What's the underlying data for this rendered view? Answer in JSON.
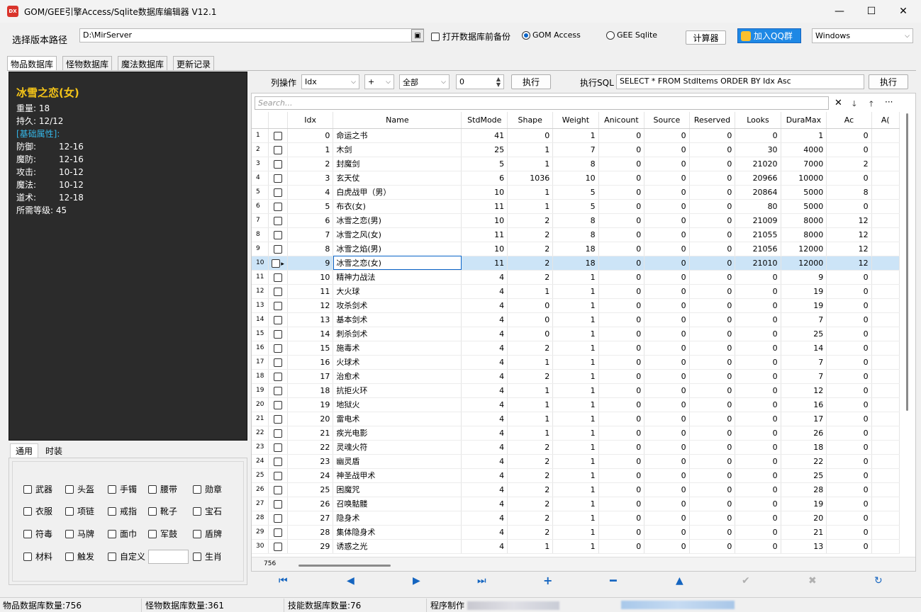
{
  "window": {
    "title": "GOM/GEE引擎Access/Sqlite数据库编辑器 V12.1",
    "icon_text": "DX",
    "minimize": "—",
    "maximize": "☐",
    "close": "✕"
  },
  "top": {
    "path_label": "选择版本路径",
    "path_value": "D:\\MirServer",
    "backup_label": "打开数据库前备份",
    "gom_label": "GOM Access",
    "gee_label": "GEE Sqlite",
    "calc_label": "计算器",
    "qq_label": "加入QQ群",
    "theme_value": "Windows"
  },
  "tabs": [
    "物品数据库",
    "怪物数据库",
    "魔法数据库",
    "更新记录"
  ],
  "preview": {
    "name": "冰雪之恋(女)",
    "lines": [
      "重量: 18",
      "持久: 12/12"
    ],
    "section": "[基础属性]:",
    "attrs": [
      {
        "k": "防御:",
        "v": "12-16"
      },
      {
        "k": "魔防:",
        "v": "12-16"
      },
      {
        "k": "攻击:",
        "v": "10-12"
      },
      {
        "k": "魔法:",
        "v": "10-12"
      },
      {
        "k": "道术:",
        "v": "12-18"
      }
    ],
    "level": "所需等级: 45",
    "name_color": "#f5c518",
    "section_color": "#35b7e8"
  },
  "subtabs": [
    "通用",
    "时装"
  ],
  "categories": [
    [
      "武器",
      "头盔",
      "手镯",
      "腰带",
      "勋章"
    ],
    [
      "衣服",
      "项链",
      "戒指",
      "靴子",
      "宝石"
    ],
    [
      "符毒",
      "马牌",
      "面巾",
      "军鼓",
      "盾牌"
    ],
    [
      "材料",
      "触发",
      "自定义",
      "生肖"
    ]
  ],
  "toolbar": {
    "col_op_label": "列操作",
    "col_value": "Idx",
    "op_value": "+",
    "scope_value": "全部",
    "num_value": "0",
    "exec_label": "执行",
    "sql_label": "执行SQL",
    "sql_value": "SELECT * FROM StdItems ORDER BY Idx Asc",
    "exec2_label": "执行"
  },
  "search": {
    "placeholder": "Search..."
  },
  "grid": {
    "columns": [
      "Idx",
      "Name",
      "StdMode",
      "Shape",
      "Weight",
      "Anicount",
      "Source",
      "Reserved",
      "Looks",
      "DuraMax",
      "Ac",
      "A("
    ],
    "rows": [
      [
        1,
        0,
        "命运之书",
        41,
        0,
        1,
        0,
        0,
        0,
        0,
        1,
        0
      ],
      [
        2,
        1,
        "木剑",
        25,
        1,
        7,
        0,
        0,
        0,
        30,
        4000,
        0
      ],
      [
        3,
        2,
        "封魔剑",
        5,
        1,
        8,
        0,
        0,
        0,
        21020,
        7000,
        2
      ],
      [
        4,
        3,
        "玄天仗",
        6,
        1036,
        10,
        0,
        0,
        0,
        20966,
        10000,
        0
      ],
      [
        5,
        4,
        "白虎战甲（男）",
        10,
        1,
        5,
        0,
        0,
        0,
        20864,
        5000,
        8
      ],
      [
        6,
        5,
        "布衣(女)",
        11,
        1,
        5,
        0,
        0,
        0,
        80,
        5000,
        0
      ],
      [
        7,
        6,
        "冰雪之恋(男)",
        10,
        2,
        8,
        0,
        0,
        0,
        21009,
        8000,
        12
      ],
      [
        8,
        7,
        "冰雪之风(女)",
        11,
        2,
        8,
        0,
        0,
        0,
        21055,
        8000,
        12
      ],
      [
        9,
        8,
        "冰雪之焰(男)",
        10,
        2,
        18,
        0,
        0,
        0,
        21056,
        12000,
        12
      ],
      [
        10,
        9,
        "冰雪之恋(女)",
        11,
        2,
        18,
        0,
        0,
        0,
        21010,
        12000,
        12
      ],
      [
        11,
        10,
        "精神力战法",
        4,
        2,
        1,
        0,
        0,
        0,
        0,
        9,
        0
      ],
      [
        12,
        11,
        "大火球",
        4,
        1,
        1,
        0,
        0,
        0,
        0,
        19,
        0
      ],
      [
        13,
        12,
        "攻杀剑术",
        4,
        0,
        1,
        0,
        0,
        0,
        0,
        19,
        0
      ],
      [
        14,
        13,
        "基本剑术",
        4,
        0,
        1,
        0,
        0,
        0,
        0,
        7,
        0
      ],
      [
        15,
        14,
        "刺杀剑术",
        4,
        0,
        1,
        0,
        0,
        0,
        0,
        25,
        0
      ],
      [
        16,
        15,
        "施毒术",
        4,
        2,
        1,
        0,
        0,
        0,
        0,
        14,
        0
      ],
      [
        17,
        16,
        "火球术",
        4,
        1,
        1,
        0,
        0,
        0,
        0,
        7,
        0
      ],
      [
        18,
        17,
        "治愈术",
        4,
        2,
        1,
        0,
        0,
        0,
        0,
        7,
        0
      ],
      [
        19,
        18,
        "抗拒火环",
        4,
        1,
        1,
        0,
        0,
        0,
        0,
        12,
        0
      ],
      [
        20,
        19,
        "地狱火",
        4,
        1,
        1,
        0,
        0,
        0,
        0,
        16,
        0
      ],
      [
        21,
        20,
        "雷电术",
        4,
        1,
        1,
        0,
        0,
        0,
        0,
        17,
        0
      ],
      [
        22,
        21,
        "疾光电影",
        4,
        1,
        1,
        0,
        0,
        0,
        0,
        26,
        0
      ],
      [
        23,
        22,
        "灵魂火符",
        4,
        2,
        1,
        0,
        0,
        0,
        0,
        18,
        0
      ],
      [
        24,
        23,
        "幽灵盾",
        4,
        2,
        1,
        0,
        0,
        0,
        0,
        22,
        0
      ],
      [
        25,
        24,
        "神圣战甲术",
        4,
        2,
        1,
        0,
        0,
        0,
        0,
        25,
        0
      ],
      [
        26,
        25,
        "困魔咒",
        4,
        2,
        1,
        0,
        0,
        0,
        0,
        28,
        0
      ],
      [
        27,
        26,
        "召唤骷髅",
        4,
        2,
        1,
        0,
        0,
        0,
        0,
        19,
        0
      ],
      [
        28,
        27,
        "隐身术",
        4,
        2,
        1,
        0,
        0,
        0,
        0,
        20,
        0
      ],
      [
        29,
        28,
        "集体隐身术",
        4,
        2,
        1,
        0,
        0,
        0,
        0,
        21,
        0
      ],
      [
        30,
        29,
        "诱惑之光",
        4,
        1,
        1,
        0,
        0,
        0,
        0,
        13,
        0
      ]
    ],
    "selected_row": 10,
    "footer_count": "756"
  },
  "status": {
    "items": "物品数据库数量:756",
    "monsters": "怪物数据库数量:361",
    "skills": "技能数据库数量:76",
    "author": "程序制作"
  }
}
